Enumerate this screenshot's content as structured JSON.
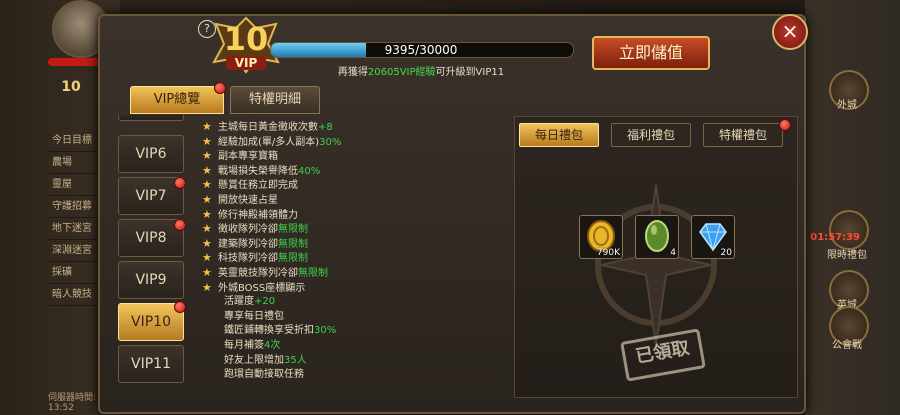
{
  "vip": {
    "level": "10",
    "badge_label": "VIP"
  },
  "progress": {
    "text": "9395/30000",
    "current": 9395,
    "max": 30000
  },
  "upgrade_msg": {
    "pre": "再獲得",
    "amount": "20605VIP經驗",
    "post": "可升級到VIP11"
  },
  "buttons": {
    "topup": "立即儲值",
    "close": "×",
    "help": "?"
  },
  "tabs": [
    {
      "label": "VIP總覽"
    },
    {
      "label": "特權明細"
    }
  ],
  "vip_list": [
    {
      "label": "VIP6"
    },
    {
      "label": "VIP7"
    },
    {
      "label": "VIP8"
    },
    {
      "label": "VIP9"
    },
    {
      "label": "VIP10"
    },
    {
      "label": "VIP11"
    }
  ],
  "benefits": [
    {
      "t": "主城每日黃金徵收次數",
      "h": "+8",
      "s": ""
    },
    {
      "t": "經驗加成(單/多人副本)",
      "h": "30%",
      "s": ""
    },
    {
      "t": "副本專享寶箱",
      "h": "",
      "s": ""
    },
    {
      "t": "戰場損失榮譽降低",
      "h": "40%",
      "s": ""
    },
    {
      "t": "懸賞任務立即完成",
      "h": "",
      "s": ""
    },
    {
      "t": "開放快速占星",
      "h": "",
      "s": ""
    },
    {
      "t": "修行神殿補領體力",
      "h": "",
      "s": ""
    },
    {
      "t": "徵收隊列冷卻",
      "h": "無限制",
      "s": ""
    },
    {
      "t": "建築隊列冷卻",
      "h": "無限制",
      "s": ""
    },
    {
      "t": "科技隊列冷卻",
      "h": "無限制",
      "s": ""
    },
    {
      "t": "英靈競技隊列冷卻",
      "h": "無限制",
      "s": ""
    },
    {
      "t": "外城BOSS座標顯示",
      "h": "",
      "s": ""
    },
    {
      "t": "活躍度",
      "h": "+20",
      "s": ""
    },
    {
      "t": "專享每日禮包",
      "h": "",
      "s": ""
    },
    {
      "t": "鐵匠鋪轉換享受折扣",
      "h": "30%",
      "s": ""
    },
    {
      "t": "每月補簽",
      "h": "4次",
      "s": ""
    },
    {
      "t": "好友上限增加",
      "h": "35人",
      "s": ""
    },
    {
      "t": "跑環自動接取任務",
      "h": "",
      "s": ""
    }
  ],
  "gift_tabs": [
    {
      "label": "每日禮包"
    },
    {
      "label": "福利禮包"
    },
    {
      "label": "特權禮包"
    }
  ],
  "gift_items": [
    {
      "icon": "gold-coin-icon",
      "count": "790K"
    },
    {
      "icon": "green-gem-icon",
      "count": "4"
    },
    {
      "icon": "blue-diamond-icon",
      "count": "20"
    }
  ],
  "claimed_stamp": "已領取",
  "side": {
    "left_menu": [
      "今日目標",
      "農場",
      "靈屋",
      "守護招募",
      "地下迷宮",
      "深淵迷宮",
      "採礦",
      "暗人競技"
    ],
    "left_vip": "10",
    "bottom_left": "伺服器時間: 13:52",
    "right_labels": [
      "外城",
      "限時禮包",
      "英城",
      "公會戰"
    ],
    "timer": "01:57:39"
  },
  "colors": {
    "highlight_green": "#3fd14c",
    "gold": "#f3c65d",
    "red_dot": "#c2170e"
  }
}
